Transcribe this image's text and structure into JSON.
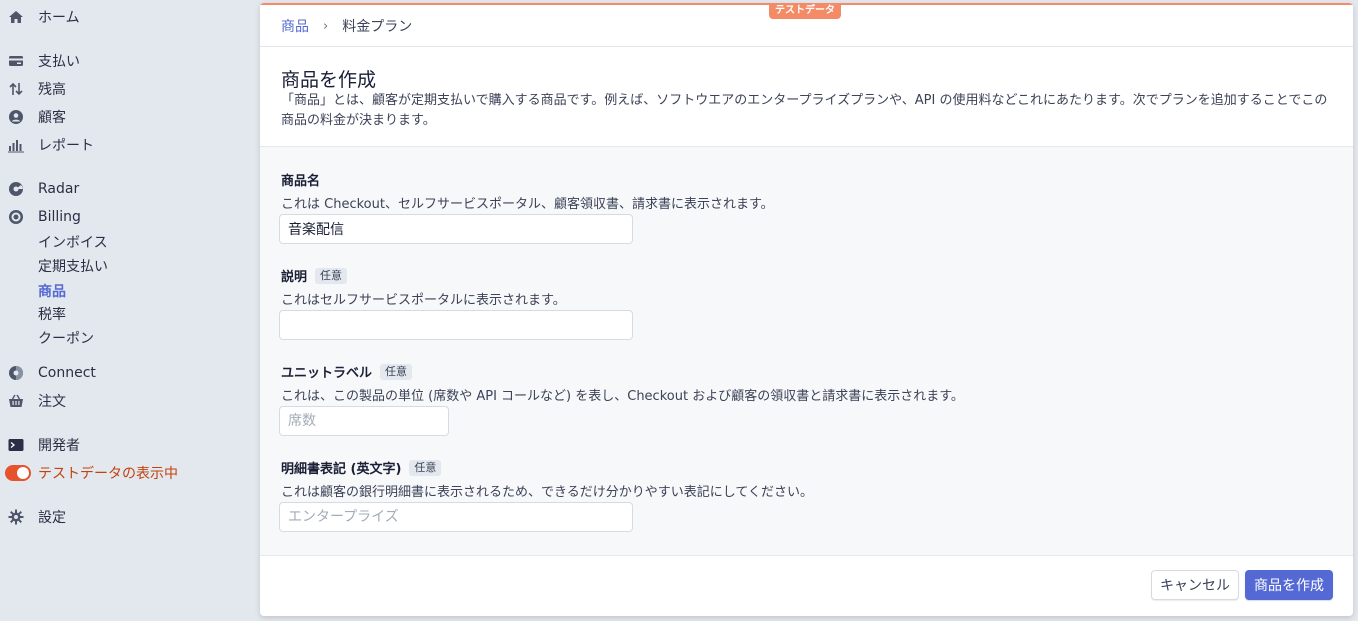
{
  "sidebar": {
    "home": "ホーム",
    "payments": "支払い",
    "balances": "残高",
    "customers": "顧客",
    "reports": "レポート",
    "radar": "Radar",
    "billing": "Billing",
    "invoices": "インボイス",
    "subscriptions": "定期支払い",
    "products": "商品",
    "tax_rates": "税率",
    "coupons": "クーポン",
    "connect": "Connect",
    "orders": "注文",
    "developers": "開発者",
    "test_data": "テストデータの表示中",
    "settings": "設定"
  },
  "header": {
    "test_badge": "テストデータ",
    "breadcrumb_link": "商品",
    "breadcrumb_sep": "›",
    "breadcrumb_current": "料金プラン"
  },
  "page": {
    "title": "商品を作成",
    "description": "「商品」とは、顧客が定期支払いで購入する商品です。例えば、ソフトウエアのエンタープライズプランや、API の使用料などこれにあたります。次でプランを追加することでこの商品の料金が決まります。"
  },
  "form": {
    "optional_tag": "任意",
    "name": {
      "label": "商品名",
      "help": "これは Checkout、セルフサービスポータル、顧客領収書、請求書に表示されます。",
      "value": "音楽配信"
    },
    "description": {
      "label": "説明",
      "help": "これはセルフサービスポータルに表示されます。",
      "value": ""
    },
    "unit_label": {
      "label": "ユニットラベル",
      "help": "これは、この製品の単位 (席数や API コールなど) を表し、Checkout および顧客の領収書と請求書に表示されます。",
      "placeholder": "席数"
    },
    "statement": {
      "label": "明細書表記 (英文字)",
      "help": "これは顧客の銀行明細書に表示されるため、できるだけ分かりやすい表記にしてください。",
      "placeholder": "エンタープライズ"
    }
  },
  "footer": {
    "cancel": "キャンセル",
    "submit": "商品を作成"
  },
  "colors": {
    "accent": "#5469d4",
    "test_mode": "#f48b67",
    "sidebar_bg": "#e3e8ee"
  }
}
